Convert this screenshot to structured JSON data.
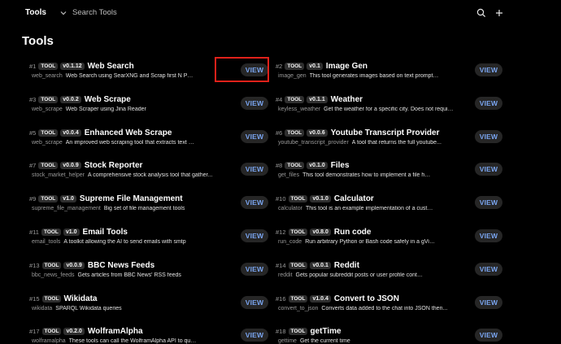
{
  "topbar": {
    "title": "Tools",
    "search_placeholder": "Search Tools"
  },
  "page_title": "Tools",
  "view_label": "VIEW",
  "tool_badge": "TOOL",
  "tools": [
    {
      "num": "#1",
      "version": "v0.1.12",
      "name": "Web Search",
      "id": "web_search",
      "desc": "Web Search using SearXNG and Scrap first N Pages"
    },
    {
      "num": "#2",
      "version": "v0.1",
      "name": "Image Gen",
      "id": "image_gen",
      "desc": "This tool generates images based on text prompts using t..."
    },
    {
      "num": "#3",
      "version": "v0.0.2",
      "name": "Web Scrape",
      "id": "web_scrape",
      "desc": "Web Scraper using Jina Reader"
    },
    {
      "num": "#4",
      "version": "v0.1.1",
      "name": "Weather",
      "id": "keyless_weather",
      "desc": "Get the weather for a specific city. Does not require a..."
    },
    {
      "num": "#5",
      "version": "v0.0.4",
      "name": "Enhanced Web Scrape",
      "id": "web_scrape",
      "desc": "An improved web scraping tool that extracts text content..."
    },
    {
      "num": "#6",
      "version": "v0.0.6",
      "name": "Youtube Transcript Provider",
      "id": "youtube_transcript_provider",
      "desc": "A tool that returns the full youtube..."
    },
    {
      "num": "#7",
      "version": "v0.0.9",
      "name": "Stock Reporter",
      "id": "stock_market_helper",
      "desc": "A comprehensive stock analysis tool that gather..."
    },
    {
      "num": "#8",
      "version": "v0.1.0",
      "name": "Files",
      "id": "get_files",
      "desc": "This tool demonstrates how to implement a file handling..."
    },
    {
      "num": "#9",
      "version": "v1.0",
      "name": "Supreme File Management",
      "id": "supreme_file_management",
      "desc": "Big set of file management tools"
    },
    {
      "num": "#10",
      "version": "v0.1.0",
      "name": "Calculator",
      "id": "calculator",
      "desc": "This tool is an example implementation of a custom..."
    },
    {
      "num": "#11",
      "version": "v1.0",
      "name": "Email Tools",
      "id": "email_tools",
      "desc": "A toolkit allowing the AI to send emails with smtp"
    },
    {
      "num": "#12",
      "version": "v0.8.0",
      "name": "Run code",
      "id": "run_code",
      "desc": "Run arbitrary Python or Bash code safely in a gVisor sandbox."
    },
    {
      "num": "#13",
      "version": "v0.0.9",
      "name": "BBC News Feeds",
      "id": "bbc_news_feeds",
      "desc": "Gets articles from BBC News' RSS feeds"
    },
    {
      "num": "#14",
      "version": "v0.0.1",
      "name": "Reddit",
      "id": "reddit",
      "desc": "Gets popular subreddit posts or user profile content from Reddit"
    },
    {
      "num": "#15",
      "version": "",
      "name": "Wikidata",
      "id": "wikidata",
      "desc": "SPARQL Wikidata queries"
    },
    {
      "num": "#16",
      "version": "v1.0.4",
      "name": "Convert to JSON",
      "id": "convert_to_json",
      "desc": "Converts data added to the chat into JSON then..."
    },
    {
      "num": "#17",
      "version": "v0.2.0",
      "name": "WolframAlpha",
      "id": "wolframalpha",
      "desc": "These tools can call the WolframAlpha API to query the..."
    },
    {
      "num": "#18",
      "version": "",
      "name": "getTime",
      "id": "gettime",
      "desc": "Get the current time"
    }
  ],
  "colors": {
    "background": "#000000",
    "view_text": "#7aa5f0",
    "highlight": "#e0211a"
  }
}
